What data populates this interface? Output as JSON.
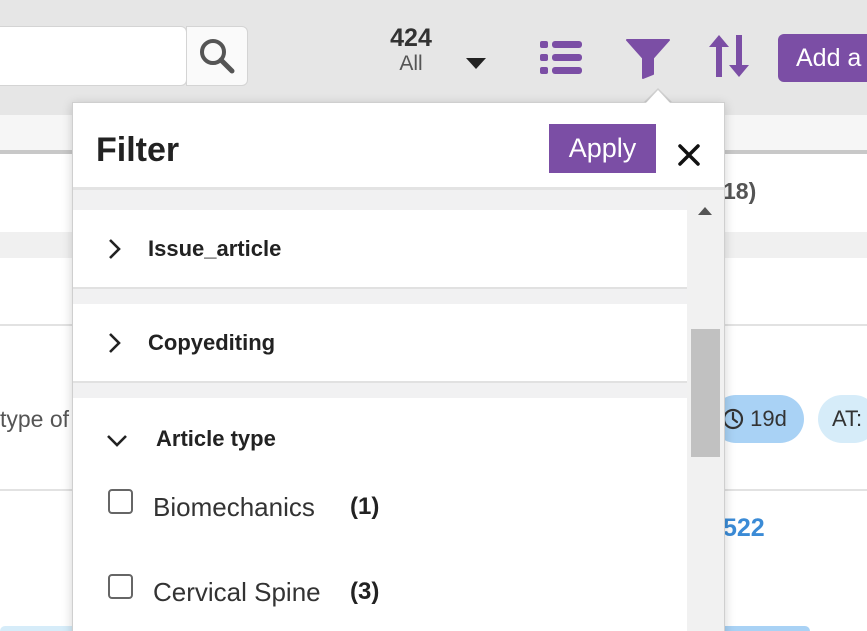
{
  "toolbar": {
    "count": "424",
    "count_filter": "All",
    "add_label": "Add a",
    "icons": [
      "search-icon",
      "caret-down-icon",
      "list-icon",
      "filter-icon",
      "sort-icon"
    ],
    "accent_color": "#7b4ea5"
  },
  "background": {
    "header_partial": "18)",
    "row_type_text": "type of",
    "chip_days": "19d",
    "chip_at": "AT:",
    "link_partial": "522"
  },
  "filter": {
    "title": "Filter",
    "apply_label": "Apply",
    "close_icon": "close-icon",
    "sections": [
      {
        "label": "Issue_article",
        "expanded": false
      },
      {
        "label": "Copyediting",
        "expanded": false
      },
      {
        "label": "Article type",
        "expanded": true
      }
    ],
    "options": [
      {
        "label": "Biomechanics",
        "count": "(1)",
        "checked": false
      },
      {
        "label": "Cervical Spine",
        "count": "(3)",
        "checked": false
      }
    ]
  }
}
